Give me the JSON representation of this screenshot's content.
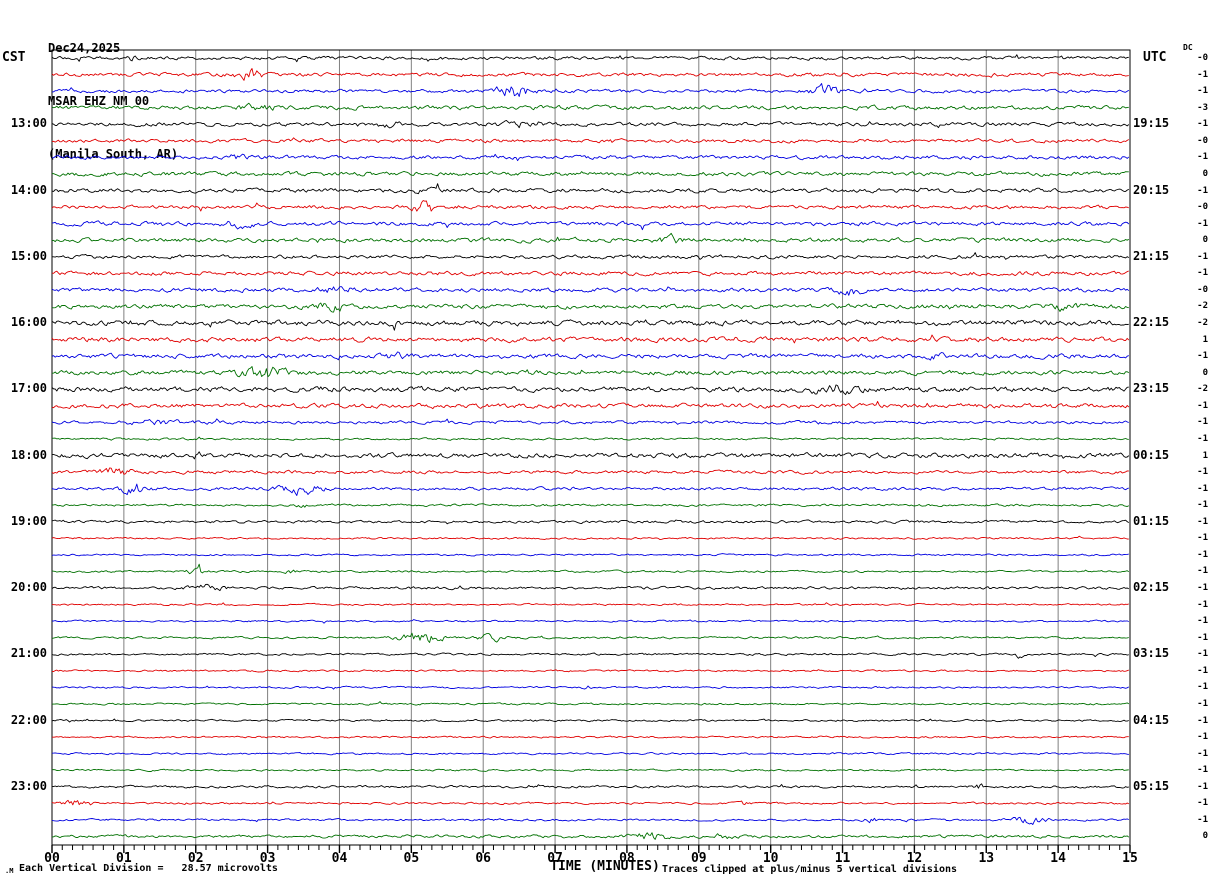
{
  "title": {
    "date": "Dec24,2025",
    "station": "MSAR EHZ NM 00",
    "location": "(Manila South, AR)"
  },
  "left_axis": {
    "label": "CST",
    "hours": [
      "13:00",
      "14:00",
      "15:00",
      "16:00",
      "17:00",
      "18:00",
      "19:00",
      "20:00",
      "21:00",
      "22:00",
      "23:00"
    ]
  },
  "right_axis": {
    "label": "UTC",
    "dc_header": "DC",
    "hours": [
      "19:15",
      "20:15",
      "21:15",
      "22:15",
      "23:15",
      "00:15",
      "01:15",
      "02:15",
      "03:15",
      "04:15",
      "05:15"
    ],
    "dc_values": [
      "-0",
      "-1",
      "-1",
      "-3",
      "-1",
      "-0",
      "-1",
      "0",
      "-1",
      "-0",
      "-1",
      "0",
      "-1",
      "-1",
      "-0",
      "-2",
      "-2",
      "1",
      "-1",
      "0",
      "-2",
      "-1",
      "-1",
      "-1",
      "1",
      "-1",
      "-1",
      "-1",
      "-1",
      "-1",
      "-1",
      "-1",
      "-1",
      "-1",
      "-1",
      "-1",
      "-1",
      "-1",
      "-1",
      "-1",
      "-1",
      "-1",
      "-1",
      "-1",
      "-1",
      "-1",
      "-1",
      "0"
    ]
  },
  "x_axis": {
    "label": "TIME (MINUTES)",
    "ticks": [
      "00",
      "01",
      "02",
      "03",
      "04",
      "05",
      "06",
      "07",
      "08",
      "09",
      "10",
      "11",
      "12",
      "13",
      "14",
      "15"
    ]
  },
  "footer": {
    "scale_note": "Each Vertical Division =   28.57 microvolts",
    "clip_note": "Traces clipped at plus/minus 5 vertical divisions",
    "corner_glyph": ".M"
  },
  "colors": {
    "black": "#000000",
    "red": "#e00000",
    "blue": "#0000e0",
    "green": "#007000",
    "grid": "#808080",
    "background": "#ffffff"
  },
  "chart_data": {
    "type": "line",
    "subtype": "helicorder-webicorder",
    "title": "MSAR EHZ NM 00 (Manila South, AR) Dec24,2025",
    "xlabel": "TIME (MINUTES)",
    "x_range_minutes": [
      0,
      15
    ],
    "minutes_per_line": 15,
    "lines_per_hour": 4,
    "num_traces": 48,
    "vertical_division_microvolts": 28.57,
    "clip_divisions": 5,
    "color_cycle": [
      "black",
      "red",
      "blue",
      "green"
    ],
    "traces": [
      {
        "start_cst": "12:00",
        "color": "black",
        "noise_amp": 1.6,
        "bursts": [
          {
            "minute": 1.05,
            "width": 0.12,
            "amp": 3
          }
        ]
      },
      {
        "start_cst": "12:15",
        "color": "red",
        "noise_amp": 1.8,
        "bursts": [
          {
            "minute": 2.75,
            "width": 0.18,
            "amp": 5
          }
        ]
      },
      {
        "start_cst": "12:30",
        "color": "blue",
        "noise_amp": 1.6,
        "bursts": [
          {
            "minute": 6.4,
            "width": 0.25,
            "amp": 6
          },
          {
            "minute": 10.75,
            "width": 0.2,
            "amp": 5
          }
        ]
      },
      {
        "start_cst": "12:45",
        "color": "green",
        "noise_amp": 2.0,
        "bursts": [
          {
            "minute": 2.9,
            "width": 0.3,
            "amp": 2
          }
        ]
      },
      {
        "start_cst": "13:00",
        "color": "black",
        "noise_amp": 1.8,
        "bursts": [
          {
            "minute": 4.7,
            "width": 0.2,
            "amp": 2
          },
          {
            "minute": 6.5,
            "width": 0.3,
            "amp": 2
          }
        ]
      },
      {
        "start_cst": "13:15",
        "color": "red",
        "noise_amp": 1.8,
        "bursts": []
      },
      {
        "start_cst": "13:30",
        "color": "blue",
        "noise_amp": 1.8,
        "bursts": [
          {
            "minute": 2.6,
            "width": 0.15,
            "amp": 2
          }
        ]
      },
      {
        "start_cst": "13:45",
        "color": "green",
        "noise_amp": 2.0,
        "bursts": []
      },
      {
        "start_cst": "14:00",
        "color": "black",
        "noise_amp": 2.0,
        "bursts": [
          {
            "minute": 5.2,
            "width": 0.2,
            "amp": 2
          }
        ]
      },
      {
        "start_cst": "14:15",
        "color": "red",
        "noise_amp": 1.8,
        "bursts": [
          {
            "minute": 5.15,
            "width": 0.12,
            "amp": 6
          }
        ]
      },
      {
        "start_cst": "14:30",
        "color": "blue",
        "noise_amp": 2.0,
        "bursts": [
          {
            "minute": 2.6,
            "width": 0.2,
            "amp": 3
          }
        ]
      },
      {
        "start_cst": "14:45",
        "color": "green",
        "noise_amp": 2.0,
        "bursts": [
          {
            "minute": 8.6,
            "width": 0.15,
            "amp": 4
          }
        ]
      },
      {
        "start_cst": "15:00",
        "color": "black",
        "noise_amp": 1.8,
        "bursts": []
      },
      {
        "start_cst": "15:15",
        "color": "red",
        "noise_amp": 2.0,
        "bursts": []
      },
      {
        "start_cst": "15:30",
        "color": "blue",
        "noise_amp": 2.0,
        "bursts": [
          {
            "minute": 11.1,
            "width": 0.15,
            "amp": 5
          },
          {
            "minute": 3.9,
            "width": 0.2,
            "amp": 2
          }
        ]
      },
      {
        "start_cst": "15:45",
        "color": "green",
        "noise_amp": 2.2,
        "bursts": [
          {
            "minute": 3.85,
            "width": 0.3,
            "amp": 3
          },
          {
            "minute": 14.1,
            "width": 0.2,
            "amp": 3
          }
        ]
      },
      {
        "start_cst": "16:00",
        "color": "black",
        "noise_amp": 2.6,
        "bursts": []
      },
      {
        "start_cst": "16:15",
        "color": "red",
        "noise_amp": 2.4,
        "bursts": []
      },
      {
        "start_cst": "16:30",
        "color": "blue",
        "noise_amp": 2.2,
        "bursts": [
          {
            "minute": 4.8,
            "width": 0.2,
            "amp": 2
          },
          {
            "minute": 12.3,
            "width": 0.1,
            "amp": 2
          }
        ]
      },
      {
        "start_cst": "16:45",
        "color": "green",
        "noise_amp": 2.2,
        "bursts": [
          {
            "minute": 2.95,
            "width": 0.35,
            "amp": 5
          }
        ]
      },
      {
        "start_cst": "17:00",
        "color": "black",
        "noise_amp": 2.5,
        "bursts": [
          {
            "minute": 10.85,
            "width": 0.3,
            "amp": 4
          }
        ]
      },
      {
        "start_cst": "17:15",
        "color": "red",
        "noise_amp": 2.2,
        "bursts": []
      },
      {
        "start_cst": "17:30",
        "color": "blue",
        "noise_amp": 1.5,
        "bursts": [
          {
            "minute": 1.5,
            "width": 0.5,
            "amp": 1.5
          }
        ]
      },
      {
        "start_cst": "17:45",
        "color": "green",
        "noise_amp": 1.0,
        "bursts": []
      },
      {
        "start_cst": "18:00",
        "color": "black",
        "noise_amp": 2.3,
        "bursts": []
      },
      {
        "start_cst": "18:15",
        "color": "red",
        "noise_amp": 1.6,
        "bursts": [
          {
            "minute": 0.9,
            "width": 0.25,
            "amp": 3
          }
        ]
      },
      {
        "start_cst": "18:30",
        "color": "blue",
        "noise_amp": 1.5,
        "bursts": [
          {
            "minute": 1.15,
            "width": 0.2,
            "amp": 5
          },
          {
            "minute": 3.45,
            "width": 0.3,
            "amp": 5
          }
        ]
      },
      {
        "start_cst": "18:45",
        "color": "green",
        "noise_amp": 1.1,
        "bursts": [
          {
            "minute": 3.5,
            "width": 0.1,
            "amp": 2
          }
        ]
      },
      {
        "start_cst": "19:00",
        "color": "black",
        "noise_amp": 1.3,
        "bursts": []
      },
      {
        "start_cst": "19:15",
        "color": "red",
        "noise_amp": 0.9,
        "bursts": []
      },
      {
        "start_cst": "19:30",
        "color": "blue",
        "noise_amp": 0.9,
        "bursts": []
      },
      {
        "start_cst": "19:45",
        "color": "green",
        "noise_amp": 1.0,
        "bursts": [
          {
            "minute": 2.0,
            "width": 0.12,
            "amp": 2.5
          },
          {
            "minute": 3.3,
            "width": 0.1,
            "amp": 1.5
          }
        ]
      },
      {
        "start_cst": "20:00",
        "color": "black",
        "noise_amp": 1.3,
        "bursts": [
          {
            "minute": 2.15,
            "width": 0.25,
            "amp": 2.5
          }
        ]
      },
      {
        "start_cst": "20:15",
        "color": "red",
        "noise_amp": 0.9,
        "bursts": []
      },
      {
        "start_cst": "20:30",
        "color": "blue",
        "noise_amp": 0.9,
        "bursts": []
      },
      {
        "start_cst": "20:45",
        "color": "green",
        "noise_amp": 1.0,
        "bursts": [
          {
            "minute": 5.15,
            "width": 0.3,
            "amp": 5
          },
          {
            "minute": 6.1,
            "width": 0.2,
            "amp": 3
          }
        ]
      },
      {
        "start_cst": "21:00",
        "color": "black",
        "noise_amp": 1.0,
        "bursts": [
          {
            "minute": 13.45,
            "width": 0.06,
            "amp": 4
          }
        ]
      },
      {
        "start_cst": "21:15",
        "color": "red",
        "noise_amp": 0.9,
        "bursts": []
      },
      {
        "start_cst": "21:30",
        "color": "blue",
        "noise_amp": 0.9,
        "bursts": [
          {
            "minute": 7.45,
            "width": 0.05,
            "amp": 3
          }
        ]
      },
      {
        "start_cst": "21:45",
        "color": "green",
        "noise_amp": 0.9,
        "bursts": []
      },
      {
        "start_cst": "22:00",
        "color": "black",
        "noise_amp": 1.0,
        "bursts": []
      },
      {
        "start_cst": "22:15",
        "color": "red",
        "noise_amp": 0.9,
        "bursts": []
      },
      {
        "start_cst": "22:30",
        "color": "blue",
        "noise_amp": 0.9,
        "bursts": []
      },
      {
        "start_cst": "22:45",
        "color": "green",
        "noise_amp": 0.9,
        "bursts": []
      },
      {
        "start_cst": "23:00",
        "color": "black",
        "noise_amp": 1.2,
        "bursts": [
          {
            "minute": 12.9,
            "width": 0.08,
            "amp": 3
          }
        ]
      },
      {
        "start_cst": "23:15",
        "color": "red",
        "noise_amp": 1.0,
        "bursts": [
          {
            "minute": 0.35,
            "width": 0.2,
            "amp": 4
          },
          {
            "minute": 9.6,
            "width": 0.1,
            "amp": 2
          }
        ]
      },
      {
        "start_cst": "23:30",
        "color": "blue",
        "noise_amp": 1.0,
        "bursts": [
          {
            "minute": 13.6,
            "width": 0.25,
            "amp": 3
          },
          {
            "minute": 11.4,
            "width": 0.1,
            "amp": 2
          }
        ]
      },
      {
        "start_cst": "23:45",
        "color": "green",
        "noise_amp": 1.4,
        "bursts": [
          {
            "minute": 8.35,
            "width": 0.3,
            "amp": 3
          },
          {
            "minute": 9.3,
            "width": 0.2,
            "amp": 2
          }
        ]
      }
    ]
  }
}
